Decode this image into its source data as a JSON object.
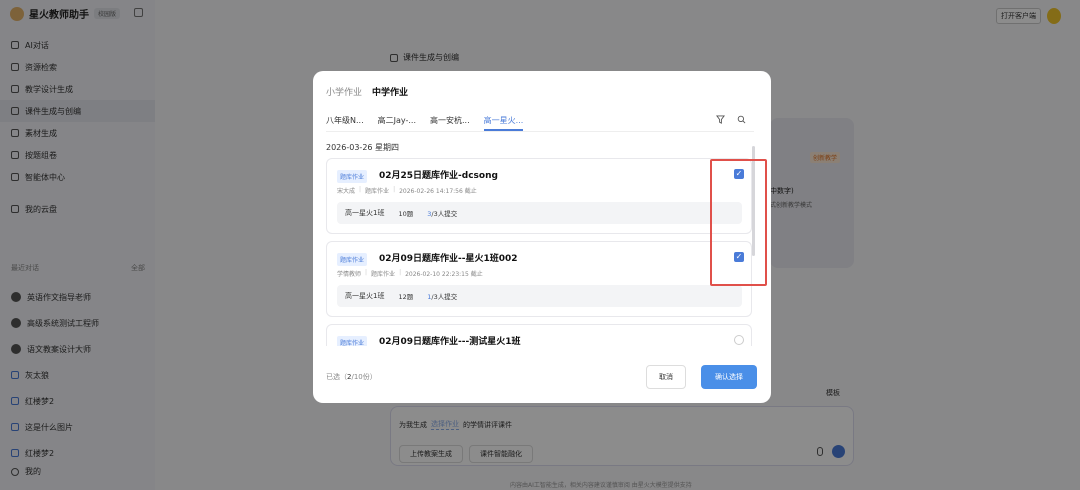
{
  "app": {
    "name": "星火教师助手",
    "badge": "校园版"
  },
  "nav": [
    {
      "label": "AI对话",
      "icon": "chat-icon"
    },
    {
      "label": "资源检索",
      "icon": "search-doc-icon"
    },
    {
      "label": "教学设计生成",
      "icon": "design-icon"
    },
    {
      "label": "课件生成与创编",
      "icon": "slides-icon"
    },
    {
      "label": "素材生成",
      "icon": "image-icon"
    },
    {
      "label": "按题组卷",
      "icon": "paper-icon"
    },
    {
      "label": "智能体中心",
      "icon": "agent-icon"
    },
    {
      "label": "我的云盘",
      "icon": "cloud-icon"
    }
  ],
  "recent": {
    "title": "最近对话",
    "all": "全部",
    "items": [
      "英语作文指导老师",
      "高级系统测试工程师",
      "语文教案设计大师",
      "灰太狼",
      "红楼梦2",
      "这是什么图片",
      "红楼梦2"
    ]
  },
  "user": {
    "label": "我的"
  },
  "header": {
    "section_title": "课件生成与创编",
    "open_client": "打开客户端"
  },
  "background": {
    "tag": "创新教学",
    "card_title": "中数字)",
    "card_sub": "式创新教学模式",
    "template_link": "模板",
    "input_prefix": "为我生成",
    "input_select": "选择作业",
    "input_suffix": "的学情讲评课件",
    "btn_upload": "上传教案生成",
    "btn_smart": "课件智能融化",
    "footnote": "内容由AI工智能生成，相关内容建议谨慎审阅 由星火大模型提供支持"
  },
  "modal": {
    "tabs": [
      {
        "label": "小学作业",
        "active": false
      },
      {
        "label": "中学作业",
        "active": true
      }
    ],
    "class_tabs": [
      {
        "label": "八年级N...",
        "active": false
      },
      {
        "label": "高二Jay-...",
        "active": false
      },
      {
        "label": "高一安杭...",
        "active": false
      },
      {
        "label": "高一星火...",
        "active": true
      }
    ],
    "date": "2026-03-26 星期四",
    "cards": [
      {
        "tag": "题库作业",
        "title": "02月25日题库作业-dcsong",
        "teacher": "宋大成",
        "type": "题库作业",
        "deadline": "2026-02-26 14:17:56 截止",
        "class": "高一星火1班",
        "count": "10题",
        "submitted": "3",
        "total": "/3人提交",
        "checked": true
      },
      {
        "tag": "题库作业",
        "title": "02月09日题库作业--星火1班002",
        "teacher": "学情教师",
        "type": "题库作业",
        "deadline": "2026-02-10 22:23:15 截止",
        "class": "高一星火1班",
        "count": "12题",
        "submitted": "1",
        "total": "/3人提交",
        "checked": true
      },
      {
        "tag": "题库作业",
        "title": "02月09日题库作业---测试星火1班",
        "teacher": "",
        "type": "",
        "deadline": "",
        "class": "",
        "count": "",
        "submitted": "",
        "total": "",
        "checked": false
      }
    ],
    "selected_prefix": "已选（",
    "selected_count": "2",
    "selected_suffix": "/10份）",
    "cancel": "取消",
    "confirm": "确认选择"
  }
}
